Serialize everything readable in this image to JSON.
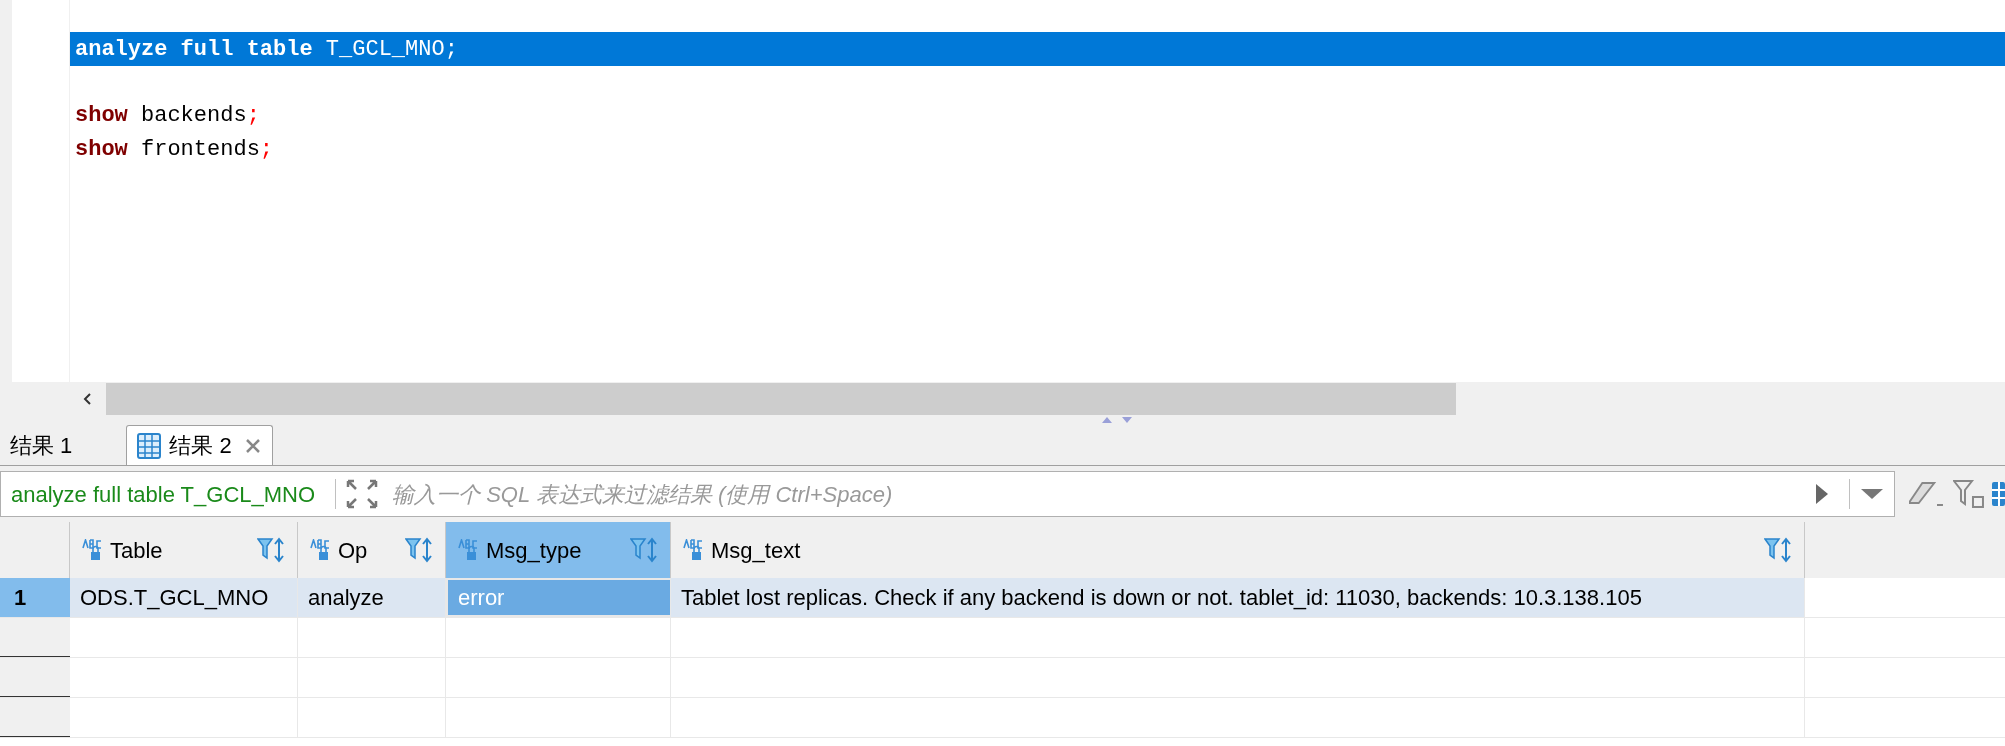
{
  "editor": {
    "lines": [
      {
        "kind": "code",
        "selected": true,
        "tokens": [
          {
            "text": "analyze full table",
            "kind": "keyword"
          },
          {
            "text": " T_GCL_MNO;",
            "kind": "plain"
          }
        ]
      },
      {
        "kind": "blank"
      },
      {
        "kind": "code",
        "selected": false,
        "tokens": [
          {
            "text": "show",
            "kind": "keyword"
          },
          {
            "text": " backends",
            "kind": "plain"
          },
          {
            "text": ";",
            "kind": "punct"
          }
        ]
      },
      {
        "kind": "code",
        "selected": false,
        "tokens": [
          {
            "text": "show",
            "kind": "keyword"
          },
          {
            "text": " frontends",
            "kind": "plain"
          },
          {
            "text": ";",
            "kind": "punct"
          }
        ]
      }
    ]
  },
  "result_tabs": [
    {
      "label": "结果 1",
      "selected": false,
      "closable": false
    },
    {
      "label": "结果 2",
      "selected": true,
      "closable": true
    }
  ],
  "filter_bar": {
    "query": "analyze full table T_GCL_MNO",
    "placeholder": "输入一个 SQL 表达式来过滤结果 (使用 Ctrl+Space)"
  },
  "table": {
    "columns": [
      {
        "name": "Table",
        "selected": false
      },
      {
        "name": "Op",
        "selected": false
      },
      {
        "name": "Msg_type",
        "selected": true
      },
      {
        "name": "Msg_text",
        "selected": false
      }
    ],
    "rows": [
      {
        "number": "1",
        "selected": true,
        "cells": [
          "ODS.T_GCL_MNO",
          "analyze",
          "error",
          "Tablet lost replicas. Check if any backend is down or not. tablet_id: 11030, backends: 10.3.138.105"
        ]
      }
    ]
  }
}
